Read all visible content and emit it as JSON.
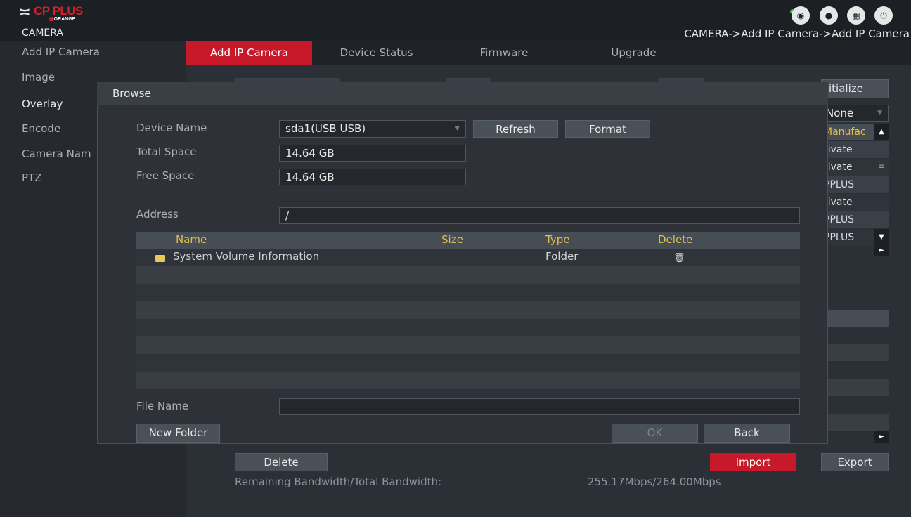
{
  "header": {
    "logo_text": "CP PLUS",
    "logo_sub": "ORANGE",
    "section": "CAMERA",
    "breadcrumb": "CAMERA->Add IP Camera->Add IP Camera"
  },
  "sidebar": {
    "items": [
      {
        "label": "Add IP Camera"
      },
      {
        "label": "Image"
      },
      {
        "label": "Overlay"
      },
      {
        "label": "Encode"
      },
      {
        "label": "Camera Nam"
      },
      {
        "label": "PTZ"
      }
    ]
  },
  "tabs": [
    {
      "label": "Add IP Camera"
    },
    {
      "label": "Device Status"
    },
    {
      "label": "Firmware"
    },
    {
      "label": "Upgrade"
    }
  ],
  "background": {
    "initialize_label": "itialize",
    "filter_value": "None",
    "list_header": "Manufac",
    "list_items": [
      "rivate",
      "rivate",
      "PPLUS",
      "rivate",
      "PPLUS",
      "PPLUS"
    ],
    "delete_label": "Delete",
    "import_label": "Import",
    "export_label": "Export",
    "bandwidth_label": "Remaining Bandwidth/Total Bandwidth:",
    "bandwidth_value": "255.17Mbps/264.00Mbps"
  },
  "dialog": {
    "title": "Browse",
    "device_name_label": "Device Name",
    "device_name_value": "sda1(USB USB)",
    "refresh_label": "Refresh",
    "format_label": "Format",
    "total_space_label": "Total Space",
    "total_space_value": "14.64 GB",
    "free_space_label": "Free Space",
    "free_space_value": "14.64 GB",
    "address_label": "Address",
    "address_value": "/",
    "columns": [
      "Name",
      "Size",
      "Type",
      "Delete"
    ],
    "files": [
      {
        "name": "System Volume Information",
        "size": "",
        "type": "Folder"
      }
    ],
    "file_name_label": "File Name",
    "file_name_value": "",
    "new_folder_label": "New Folder",
    "ok_label": "OK",
    "back_label": "Back"
  },
  "colors": {
    "accent_red": "#c7192a",
    "header_yellow": "#e0c04a"
  }
}
